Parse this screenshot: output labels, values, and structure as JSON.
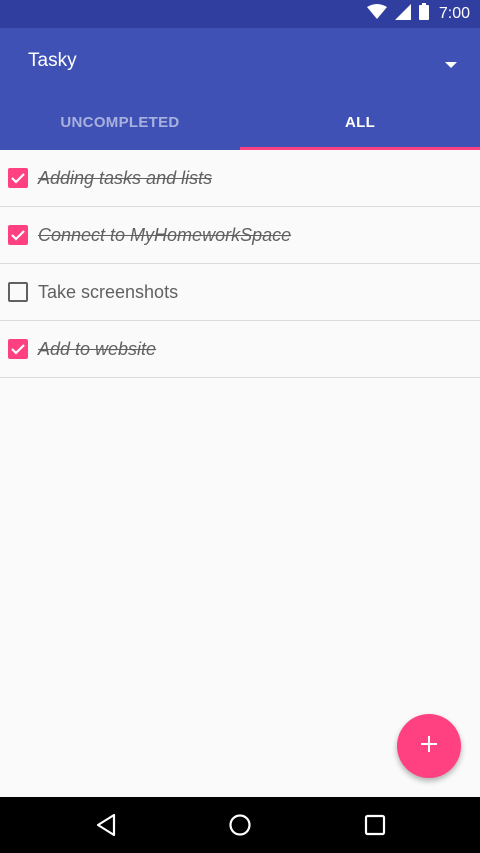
{
  "status_bar": {
    "time": "7:00",
    "icons": [
      "wifi-icon",
      "signal-icon",
      "battery-icon"
    ]
  },
  "app_bar": {
    "title": "Tasky",
    "dropdown_icon": "arrow-drop-down-icon",
    "tabs": [
      {
        "label": "UNCOMPLETED",
        "selected": false
      },
      {
        "label": "ALL",
        "selected": true
      }
    ]
  },
  "tasks": [
    {
      "label": "Adding tasks and lists",
      "checked": true
    },
    {
      "label": "Connect to MyHomeworkSpace",
      "checked": true
    },
    {
      "label": "Take screenshots",
      "checked": false
    },
    {
      "label": "Add to website",
      "checked": true
    }
  ],
  "fab": {
    "icon": "plus-icon"
  },
  "nav_bar": {
    "icons": [
      "back-icon",
      "home-icon",
      "recents-icon"
    ]
  },
  "colors": {
    "primary": "#3f51b5",
    "primary_dark": "#303f9f",
    "accent": "#ff4081"
  }
}
